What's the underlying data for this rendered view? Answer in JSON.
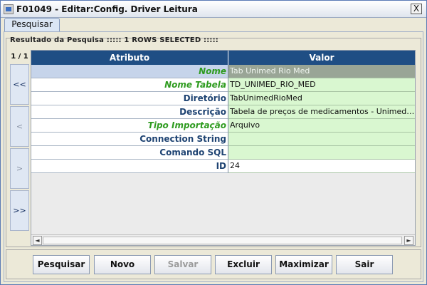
{
  "window": {
    "title": "F01049 - Editar:Config. Driver Leitura",
    "close_label": "X"
  },
  "tabs": [
    {
      "label": "Pesquisar"
    }
  ],
  "results": {
    "title": "Resultado da Pesquisa ::::: 1 ROWS SELECTED :::::",
    "pager": "1 / 1",
    "nav": {
      "first": "<<",
      "prev": "<",
      "next": ">",
      "last": ">>"
    }
  },
  "grid": {
    "columns": [
      "Atributo",
      "Valor"
    ],
    "rows": [
      {
        "attr": "Nome",
        "value": "Tab Unimed Rio Med"
      },
      {
        "attr": "Nome Tabela",
        "value": "TD_UNIMED_RIO_MED"
      },
      {
        "attr": "Diretório",
        "value": "TabUnimedRioMed"
      },
      {
        "attr": "Descrição",
        "value": "Tabela de preços de medicamentos - Unimed Rio"
      },
      {
        "attr": "Tipo Importação",
        "value": "Arquivo"
      },
      {
        "attr": "Connection String",
        "value": ""
      },
      {
        "attr": "Comando SQL",
        "value": ""
      },
      {
        "attr": "ID",
        "value": "24"
      }
    ],
    "scroll": {
      "left": "◄",
      "right": "►"
    }
  },
  "buttons": {
    "pesquisar": "Pesquisar",
    "novo": "Novo",
    "salvar": "Salvar",
    "excluir": "Excluir",
    "maximizar": "Maximizar",
    "sair": "Sair"
  },
  "colors": {
    "header_bg": "#1f4e84",
    "required_label": "#2e9b1f",
    "value_bg": "#d9f7d0",
    "selected_value_bg": "#99a596"
  }
}
